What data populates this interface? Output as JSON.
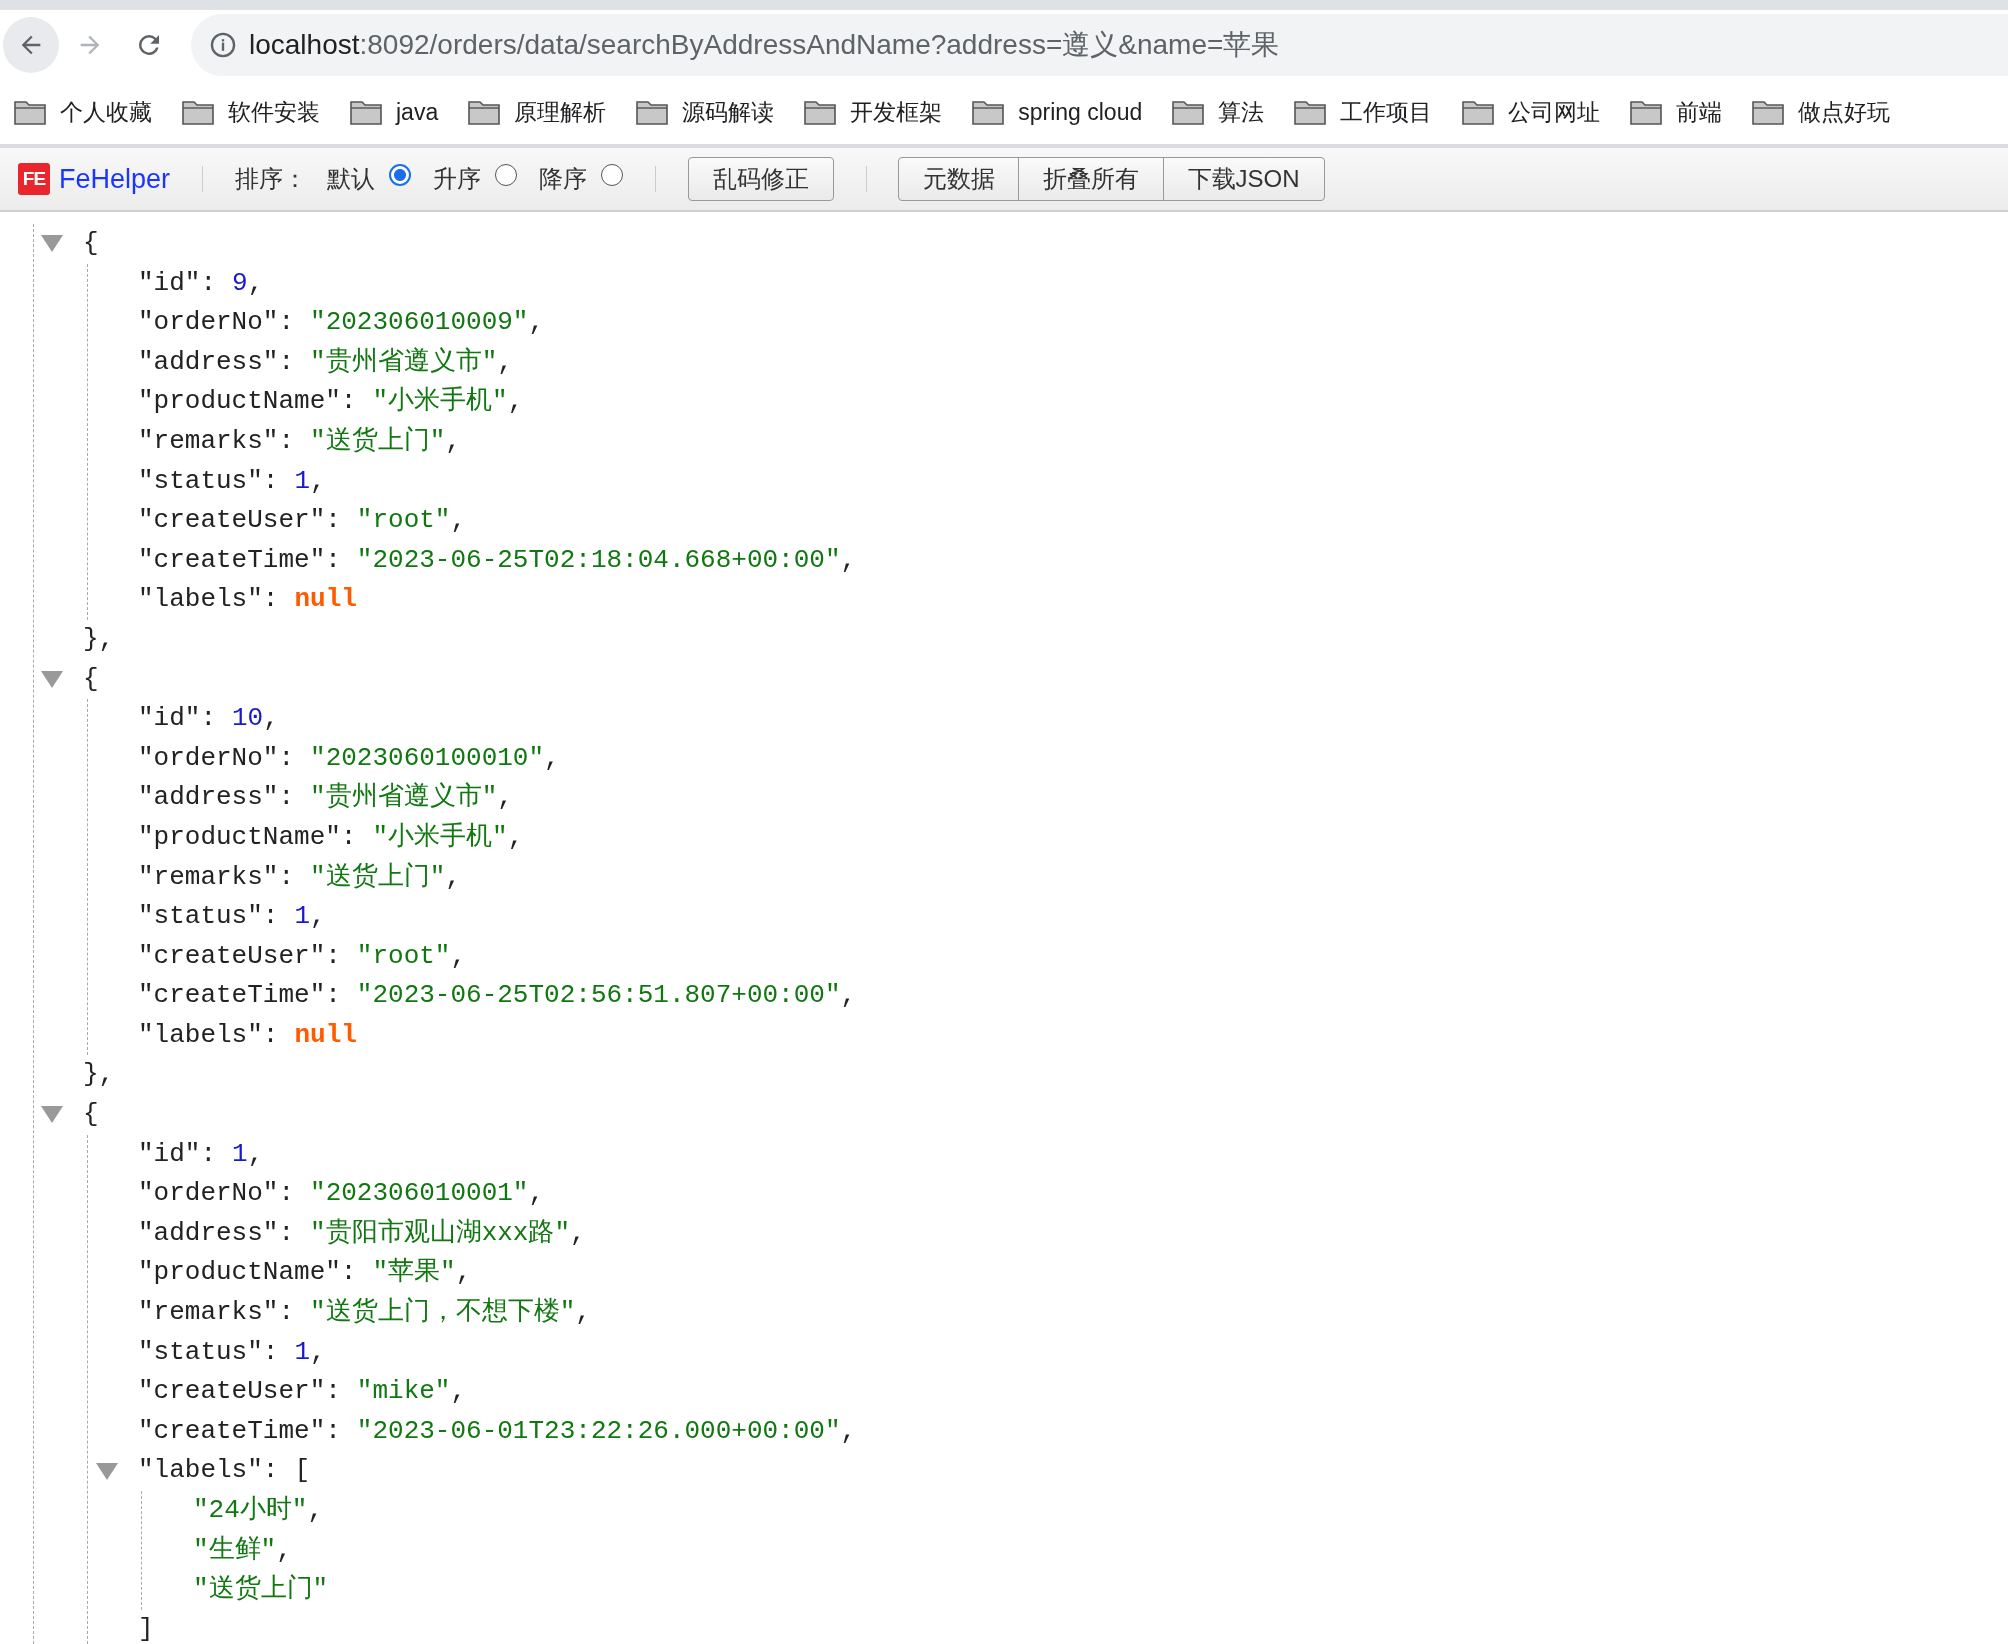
{
  "address_bar": {
    "url_host": "localhost",
    "url_rest": ":8092/orders/data/searchByAddressAndName?address=遵义&name=苹果",
    "forward_disabled": true
  },
  "bookmarks": [
    {
      "label": "个人收藏"
    },
    {
      "label": "软件安装"
    },
    {
      "label": "java"
    },
    {
      "label": "原理解析"
    },
    {
      "label": "源码解读"
    },
    {
      "label": "开发框架"
    },
    {
      "label": "spring cloud"
    },
    {
      "label": "算法"
    },
    {
      "label": "工作项目"
    },
    {
      "label": "公司网址"
    },
    {
      "label": "前端"
    },
    {
      "label": "做点好玩"
    }
  ],
  "toolbar": {
    "logo_text": "FE",
    "brand": "FeHelper",
    "sort_label": "排序：",
    "sort_options": [
      {
        "label": "默认",
        "selected": true
      },
      {
        "label": "升序",
        "selected": false
      },
      {
        "label": "降序",
        "selected": false
      }
    ],
    "fix_button": "乱码修正",
    "buttons": [
      "元数据",
      "折叠所有",
      "下载JSON"
    ]
  },
  "json_view": {
    "objects": [
      {
        "expanded": true,
        "open": "{",
        "close": "},",
        "fields": [
          {
            "key": "\"id\":",
            "kind": "number",
            "value": "9",
            "comma": ","
          },
          {
            "key": "\"orderNo\":",
            "kind": "string",
            "value": "\"202306010009\"",
            "comma": ","
          },
          {
            "key": "\"address\":",
            "kind": "string",
            "value": "\"贵州省遵义市\"",
            "comma": ","
          },
          {
            "key": "\"productName\":",
            "kind": "string",
            "value": "\"小米手机\"",
            "comma": ","
          },
          {
            "key": "\"remarks\":",
            "kind": "string",
            "value": "\"送货上门\"",
            "comma": ","
          },
          {
            "key": "\"status\":",
            "kind": "number",
            "value": "1",
            "comma": ","
          },
          {
            "key": "\"createUser\":",
            "kind": "string",
            "value": "\"root\"",
            "comma": ","
          },
          {
            "key": "\"createTime\":",
            "kind": "string",
            "value": "\"2023-06-25T02:18:04.668+00:00\"",
            "comma": ","
          },
          {
            "key": "\"labels\":",
            "kind": "null",
            "value": "null"
          }
        ]
      },
      {
        "expanded": true,
        "open": "{",
        "close": "},",
        "fields": [
          {
            "key": "\"id\":",
            "kind": "number",
            "value": "10",
            "comma": ","
          },
          {
            "key": "\"orderNo\":",
            "kind": "string",
            "value": "\"2023060100010\"",
            "comma": ","
          },
          {
            "key": "\"address\":",
            "kind": "string",
            "value": "\"贵州省遵义市\"",
            "comma": ","
          },
          {
            "key": "\"productName\":",
            "kind": "string",
            "value": "\"小米手机\"",
            "comma": ","
          },
          {
            "key": "\"remarks\":",
            "kind": "string",
            "value": "\"送货上门\"",
            "comma": ","
          },
          {
            "key": "\"status\":",
            "kind": "number",
            "value": "1",
            "comma": ","
          },
          {
            "key": "\"createUser\":",
            "kind": "string",
            "value": "\"root\"",
            "comma": ","
          },
          {
            "key": "\"createTime\":",
            "kind": "string",
            "value": "\"2023-06-25T02:56:51.807+00:00\"",
            "comma": ","
          },
          {
            "key": "\"labels\":",
            "kind": "null",
            "value": "null"
          }
        ]
      },
      {
        "expanded": true,
        "open": "{",
        "fields": [
          {
            "key": "\"id\":",
            "kind": "number",
            "value": "1",
            "comma": ","
          },
          {
            "key": "\"orderNo\":",
            "kind": "string",
            "value": "\"202306010001\"",
            "comma": ","
          },
          {
            "key": "\"address\":",
            "kind": "string",
            "value": "\"贵阳市观山湖xxx路\"",
            "comma": ","
          },
          {
            "key": "\"productName\":",
            "kind": "string",
            "value": "\"苹果\"",
            "comma": ","
          },
          {
            "key": "\"remarks\":",
            "kind": "string",
            "value": "\"送货上门，不想下楼\"",
            "comma": ","
          },
          {
            "key": "\"status\":",
            "kind": "number",
            "value": "1",
            "comma": ","
          },
          {
            "key": "\"createUser\":",
            "kind": "string",
            "value": "\"mike\"",
            "comma": ","
          },
          {
            "key": "\"createTime\":",
            "kind": "string",
            "value": "\"2023-06-01T23:22:26.000+00:00\"",
            "comma": ","
          },
          {
            "key": "\"labels\":",
            "kind": "array",
            "expanded": true,
            "open": "[",
            "close": "]",
            "items": [
              {
                "kind": "string",
                "value": "\"24小时\"",
                "comma": ","
              },
              {
                "kind": "string",
                "value": "\"生鲜\"",
                "comma": ","
              },
              {
                "kind": "string",
                "value": "\"送货上门\""
              }
            ]
          }
        ]
      }
    ]
  }
}
